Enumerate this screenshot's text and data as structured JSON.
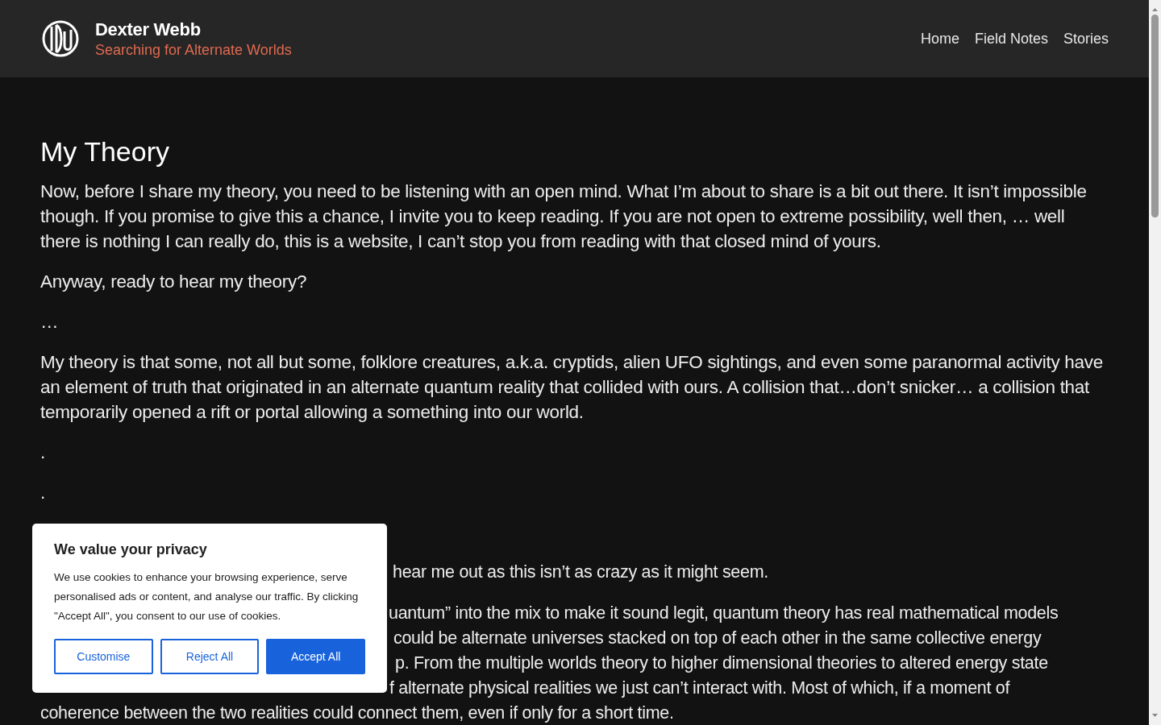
{
  "header": {
    "site_title": "Dexter Webb",
    "tagline": "Searching for Alternate Worlds",
    "nav": [
      {
        "label": "Home"
      },
      {
        "label": "Field Notes"
      },
      {
        "label": "Stories"
      }
    ]
  },
  "article": {
    "title": "My Theory",
    "paragraphs": [
      "Now, before I share my theory, you need to be listening with an open mind. What I’m about to share is a bit out there. It isn’t impossible though. If you promise to give this a chance, I invite you to keep reading. If you are not open to extreme possibility, well then, … well there is nothing I can really do, this is a website, I can’t stop you from reading with that closed mind of yours.",
      "Anyway, ready to hear my theory?",
      "…",
      "My theory is that some, not all but some, folklore creatures, a.k.a. cryptids, alien UFO sightings, and even some paranormal activity have an element of truth that originated in an alternate quantum reality that collided with ours. A collision that…don’t snicker… a collision that temporarily opened a rift or portal allowing a something into our world.",
      ".",
      "."
    ],
    "covered_lines": [
      "hear me out as this isn’t as crazy as it might seem.",
      "uantum” into the mix to make it sound legit, quantum theory has real mathematical models",
      "could be alternate universes stacked on top of each other in the same collective energy",
      "p. From the multiple worlds theory to higher dimensional theories to altered energy state",
      "f alternate physical realities we just can’t interact with. Most of which, if a moment of",
      "coherence between the two realities could connect them, even if only for a short time."
    ]
  },
  "cookie_banner": {
    "title": "We value your privacy",
    "text": "We use cookies to enhance your browsing experience, serve personalised ads or content, and analyse our traffic. By clicking \"Accept All\", you consent to our use of cookies.",
    "buttons": [
      {
        "label": "Customise",
        "kind": "outline"
      },
      {
        "label": "Reject All",
        "kind": "outline"
      },
      {
        "label": "Accept All",
        "kind": "primary"
      }
    ]
  }
}
